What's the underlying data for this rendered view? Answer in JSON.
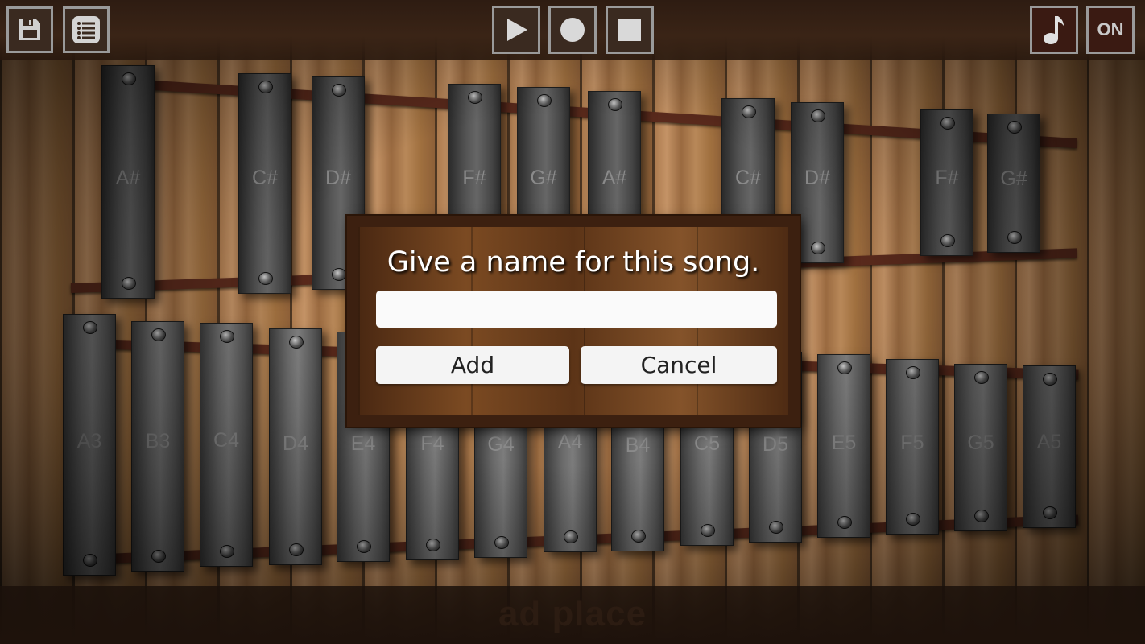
{
  "toolbar": {
    "left": [
      {
        "name": "save-button",
        "icon": "floppy-disk-icon"
      },
      {
        "name": "song-list-button",
        "icon": "list-icon"
      }
    ],
    "center": [
      {
        "name": "play-button",
        "icon": "play-icon"
      },
      {
        "name": "record-button",
        "icon": "record-icon"
      },
      {
        "name": "stop-button",
        "icon": "stop-icon"
      }
    ],
    "right": [
      {
        "name": "note-label-toggle",
        "icon": "music-note-icon"
      },
      {
        "name": "sound-toggle",
        "label": "ON"
      }
    ]
  },
  "upper_row": [
    "A#",
    "C#",
    "D#",
    "F#",
    "G#",
    "A#",
    "C#",
    "D#",
    "F#",
    "G#"
  ],
  "lower_row": [
    "A3",
    "B3",
    "C4",
    "D4",
    "E4",
    "F4",
    "G4",
    "A4",
    "B4",
    "C5",
    "D5",
    "E5",
    "F5",
    "G5",
    "A5"
  ],
  "dialog": {
    "title": "Give a name for this song.",
    "input_value": "",
    "add_label": "Add",
    "cancel_label": "Cancel"
  },
  "ad": {
    "text": "ad place"
  },
  "colors": {
    "wood": "#a8764a",
    "rail": "#5a2a1c",
    "button_border": "#9a9a9a",
    "dialog_wood": "#5c3417"
  }
}
